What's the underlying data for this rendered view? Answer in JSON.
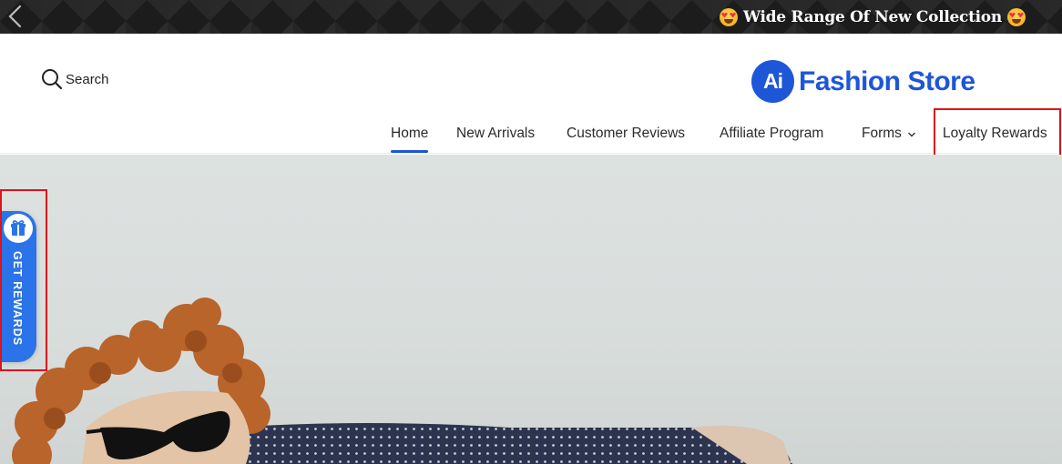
{
  "announcement": {
    "text": "Wide Range Of New Collection",
    "prev_icon": "chevron-left-icon",
    "emoji_icon": "heart-eyes-emoji-icon"
  },
  "header": {
    "search_label": "Search",
    "search_icon": "search-icon",
    "logo_badge": "Ai",
    "logo_text": "Fashion Store",
    "brand_color": "#1e56d8"
  },
  "nav": {
    "items": [
      {
        "label": "Home",
        "active": true
      },
      {
        "label": "New Arrivals"
      },
      {
        "label": "Customer Reviews"
      },
      {
        "label": "Affiliate Program"
      },
      {
        "label": "Forms",
        "has_dropdown": true
      },
      {
        "label": "Loyalty Rewards"
      }
    ]
  },
  "rewards_widget": {
    "label": "GET REWARDS",
    "icon": "gift-icon",
    "color": "#2b73e8"
  },
  "highlight_color": "#e0121a"
}
